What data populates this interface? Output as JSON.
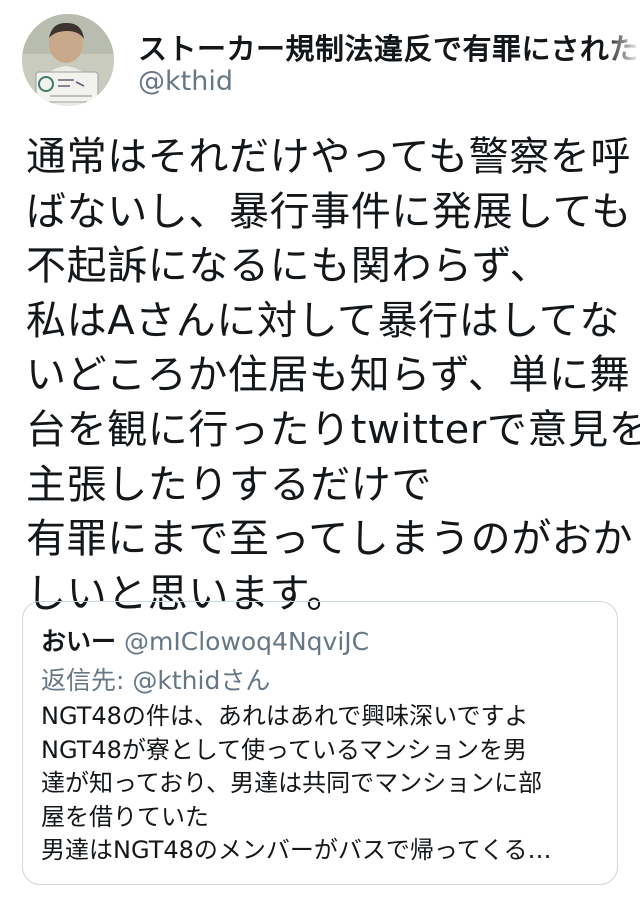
{
  "author": {
    "display_name": "ストーカー規制法違反で有罪にされた大西",
    "handle": "@kthid",
    "avatar_icon": "user-avatar-photo"
  },
  "tweet": {
    "lines": [
      "通常はそれだけやっても警察を呼",
      "ばないし、暴行事件に発展しても",
      "不起訴になるにも関わらず、",
      "私はAさんに対して暴行はしてな",
      "いどころか住居も知らず、単に舞",
      "台を観に行ったりtwitterで意見を",
      "主張したりするだけで",
      "有罪にまで至ってしまうのがおか",
      "しいと思います。"
    ]
  },
  "quoted_tweet": {
    "display_name": "おいー",
    "handle": "@mIClowoq4NqviJC",
    "reply_prefix": "返信先: ",
    "reply_to": "@kthidさん",
    "lines": [
      "NGT48の件は、あれはあれで興味深いですよ",
      "NGT48が寮として使っているマンションを男",
      "達が知っており、男達は共同でマンションに部",
      "屋を借りていた",
      "男達はNGT48のメンバーがバスで帰ってくる…"
    ]
  },
  "colors": {
    "text": "#14171a",
    "secondary": "#657786",
    "border": "#ccd6dd"
  }
}
